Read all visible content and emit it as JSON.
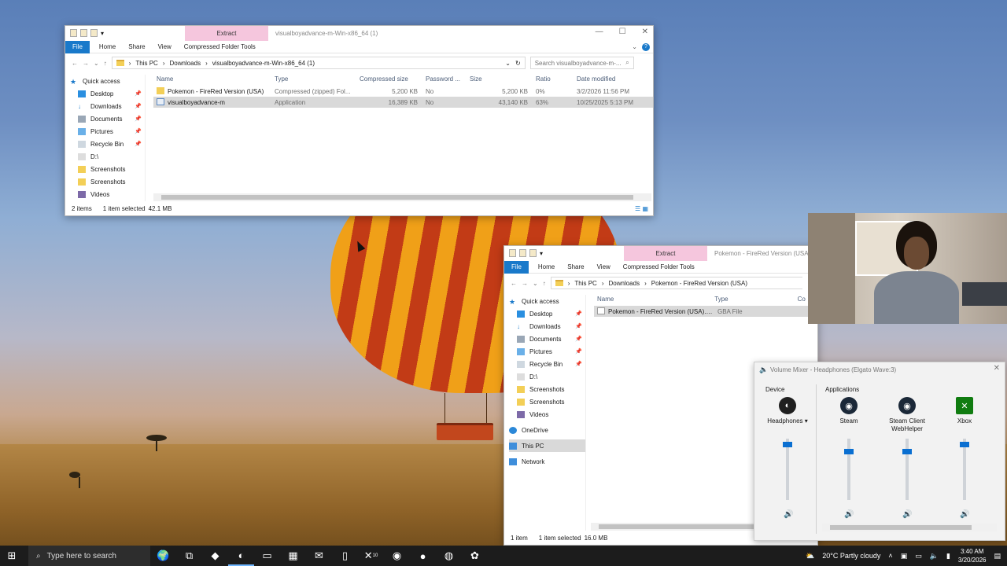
{
  "explorer1": {
    "title": "visualboyadvance-m-Win-x86_64 (1)",
    "extract_tab": "Extract",
    "ribbon": {
      "file": "File",
      "home": "Home",
      "share": "Share",
      "view": "View",
      "compressed": "Compressed Folder Tools"
    },
    "path": [
      "This PC",
      "Downloads",
      "visualboyadvance-m-Win-x86_64 (1)"
    ],
    "search_placeholder": "Search visualboyadvance-m-...",
    "nav": [
      {
        "label": "Quick access",
        "icon": "star-icon",
        "pinned": false
      },
      {
        "label": "Desktop",
        "icon": "desktop-icon",
        "pinned": true
      },
      {
        "label": "Downloads",
        "icon": "download-icon",
        "pinned": true
      },
      {
        "label": "Documents",
        "icon": "documents-icon",
        "pinned": true
      },
      {
        "label": "Pictures",
        "icon": "pictures-icon",
        "pinned": true
      },
      {
        "label": "Recycle Bin",
        "icon": "recycle-bin-icon",
        "pinned": true
      },
      {
        "label": "D:\\",
        "icon": "drive-icon",
        "pinned": false
      },
      {
        "label": "Screenshots",
        "icon": "folder-icon",
        "pinned": false
      },
      {
        "label": "Screenshots",
        "icon": "folder-icon",
        "pinned": false
      },
      {
        "label": "Videos",
        "icon": "videos-icon",
        "pinned": false
      }
    ],
    "columns": [
      "Name",
      "Type",
      "Compressed size",
      "Password ...",
      "Size",
      "Ratio",
      "Date modified"
    ],
    "rows": [
      {
        "name": "Pokemon - FireRed Version (USA)",
        "type": "Compressed (zipped) Fol...",
        "compressed": "5,200 KB",
        "password": "No",
        "size": "5,200 KB",
        "ratio": "0%",
        "date": "3/2/2026 11:56 PM",
        "selected": false,
        "icon": "zip-folder-icon"
      },
      {
        "name": "visualboyadvance-m",
        "type": "Application",
        "compressed": "16,389 KB",
        "password": "No",
        "size": "43,140 KB",
        "ratio": "63%",
        "date": "10/25/2025 5:13 PM",
        "selected": true,
        "icon": "application-icon"
      }
    ],
    "status": {
      "count": "2 items",
      "selected": "1 item selected",
      "size": "42.1 MB"
    }
  },
  "explorer2": {
    "title": "Pokemon - FireRed Version (USA)",
    "extract_tab": "Extract",
    "ribbon": {
      "file": "File",
      "home": "Home",
      "share": "Share",
      "view": "View",
      "compressed": "Compressed Folder Tools"
    },
    "path": [
      "This PC",
      "Downloads",
      "Pokemon - FireRed Version (USA)"
    ],
    "nav": [
      {
        "label": "Quick access",
        "icon": "star-icon",
        "pinned": false
      },
      {
        "label": "Desktop",
        "icon": "desktop-icon",
        "pinned": true
      },
      {
        "label": "Downloads",
        "icon": "download-icon",
        "pinned": true
      },
      {
        "label": "Documents",
        "icon": "documents-icon",
        "pinned": true
      },
      {
        "label": "Pictures",
        "icon": "pictures-icon",
        "pinned": true
      },
      {
        "label": "Recycle Bin",
        "icon": "recycle-bin-icon",
        "pinned": true
      },
      {
        "label": "D:\\",
        "icon": "drive-icon",
        "pinned": false
      },
      {
        "label": "Screenshots",
        "icon": "folder-icon",
        "pinned": false
      },
      {
        "label": "Screenshots",
        "icon": "folder-icon",
        "pinned": false
      },
      {
        "label": "Videos",
        "icon": "videos-icon",
        "pinned": false
      },
      {
        "label": "OneDrive",
        "icon": "onedrive-icon",
        "pinned": false
      },
      {
        "label": "This PC",
        "icon": "this-pc-icon",
        "pinned": false
      },
      {
        "label": "Network",
        "icon": "network-icon",
        "pinned": false
      }
    ],
    "columns": [
      "Name",
      "Type",
      "Co"
    ],
    "rows": [
      {
        "name": "Pokemon - FireRed Version (USA).g...",
        "type": "GBA File"
      }
    ],
    "status": {
      "count": "1 item",
      "selected": "1 item selected",
      "size": "16.0 MB"
    }
  },
  "mixer": {
    "title": "Volume Mixer - Headphones (Elgato Wave:3)",
    "device_header": "Device",
    "apps_header": "Applications",
    "device": {
      "label": "Headphones",
      "level": 0.95
    },
    "apps": [
      {
        "label": "Steam",
        "level": 0.82,
        "color": "#1b2838"
      },
      {
        "label": "Steam Client WebHelper",
        "level": 0.82,
        "color": "#1b2838"
      },
      {
        "label": "Xbox",
        "level": 0.95,
        "color": "#107c10"
      }
    ]
  },
  "taskbar": {
    "search_placeholder": "Type here to search",
    "weather": "20°C  Partly cloudy",
    "time": "3:40 AM",
    "date": "3/20/2026",
    "xbox_badge": "10"
  },
  "colors": {
    "accent": "#1979ca",
    "extract_tab": "#f5c6dd",
    "selected_row": "#d9d9d9"
  }
}
